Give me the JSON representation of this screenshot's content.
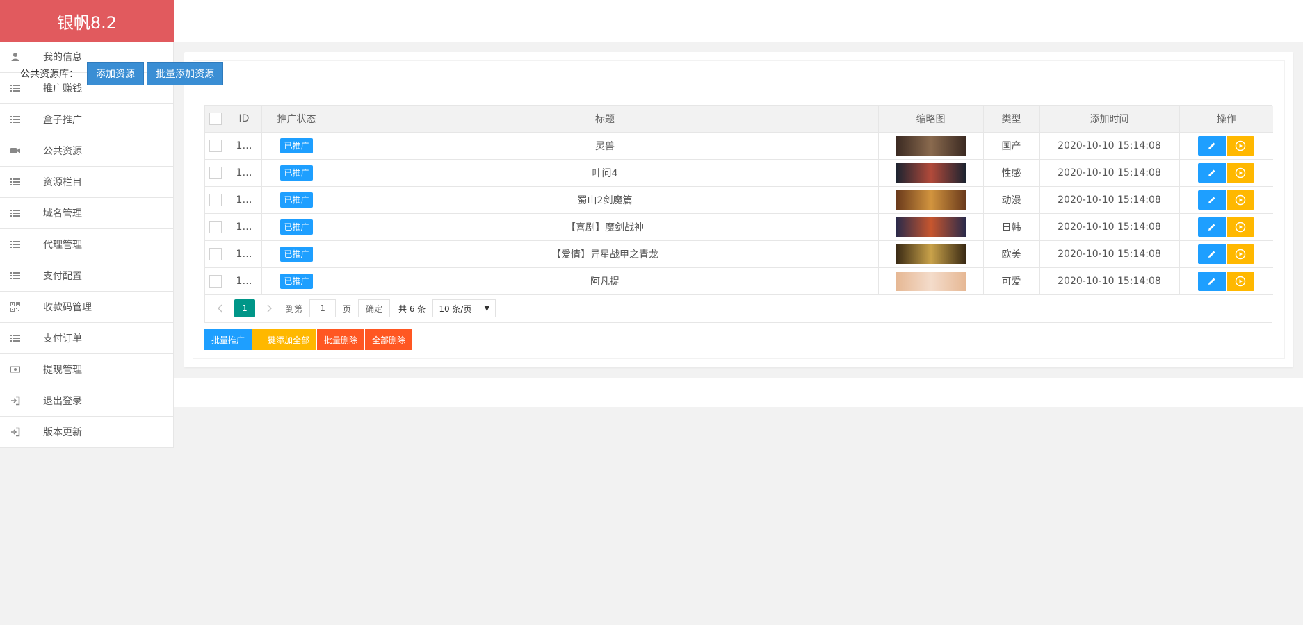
{
  "app": {
    "title": "银帆8.2"
  },
  "sidebar": {
    "items": [
      {
        "label": "我的信息",
        "icon": "user-icon"
      },
      {
        "label": "推广赚钱",
        "icon": "list-icon"
      },
      {
        "label": "盒子推广",
        "icon": "list-icon"
      },
      {
        "label": "公共资源",
        "icon": "video-camera-icon"
      },
      {
        "label": "资源栏目",
        "icon": "list-icon"
      },
      {
        "label": "域名管理",
        "icon": "list-icon"
      },
      {
        "label": "代理管理",
        "icon": "list-icon"
      },
      {
        "label": "支付配置",
        "icon": "list-icon"
      },
      {
        "label": "收款码管理",
        "icon": "qrcode-icon"
      },
      {
        "label": "支付订单",
        "icon": "list-icon"
      },
      {
        "label": "提现管理",
        "icon": "money-icon"
      },
      {
        "label": "退出登录",
        "icon": "sign-in-icon"
      },
      {
        "label": "版本更新",
        "icon": "sign-in-icon"
      }
    ]
  },
  "toolbar": {
    "label": "公共资源库：",
    "add_label": "添加资源",
    "batch_add_label": "批量添加资源"
  },
  "table": {
    "headers": [
      "",
      "ID",
      "推广状态",
      "标题",
      "缩略图",
      "类型",
      "添加时间",
      "操作"
    ],
    "rows": [
      {
        "id": "1…",
        "status": "已推广",
        "title": "灵兽",
        "type": "国产",
        "time": "2020-10-10 15:14:08",
        "thumb_colors": [
          "#3b2a22",
          "#8a6a4e"
        ]
      },
      {
        "id": "1…",
        "status": "已推广",
        "title": "叶问4",
        "type": "性感",
        "time": "2020-10-10 15:14:08",
        "thumb_colors": [
          "#1c2330",
          "#b24a3a"
        ]
      },
      {
        "id": "1…",
        "status": "已推广",
        "title": "蜀山2剑魔篇",
        "type": "动漫",
        "time": "2020-10-10 15:14:08",
        "thumb_colors": [
          "#6a3a1c",
          "#d2943e"
        ]
      },
      {
        "id": "1…",
        "status": "已推广",
        "title": "【喜剧】魔剑战神",
        "type": "日韩",
        "time": "2020-10-10 15:14:08",
        "thumb_colors": [
          "#2a2a4a",
          "#c7562e"
        ]
      },
      {
        "id": "1…",
        "status": "已推广",
        "title": "【爱情】异星战甲之青龙",
        "type": "欧美",
        "time": "2020-10-10 15:14:08",
        "thumb_colors": [
          "#3a2a14",
          "#c9a24a"
        ]
      },
      {
        "id": "1…",
        "status": "已推广",
        "title": "阿凡提",
        "type": "可爱",
        "time": "2020-10-10 15:14:08",
        "thumb_colors": [
          "#e6b894",
          "#f4dccb"
        ]
      }
    ]
  },
  "pager": {
    "current": "1",
    "goto_label": "到第",
    "goto_value": "1",
    "page_unit": "页",
    "confirm_label": "确定",
    "total_label": "共 6 条",
    "limit_label": "10 条/页"
  },
  "actions": {
    "batch_promote": "批量推广",
    "add_all": "一键添加全部",
    "batch_delete": "批量删除",
    "delete_all": "全部删除"
  },
  "colors": {
    "brand": "#e15a5e",
    "primary": "#1e9fff",
    "warm": "#ffb800",
    "danger": "#ff5722",
    "pager_active": "#009688"
  }
}
